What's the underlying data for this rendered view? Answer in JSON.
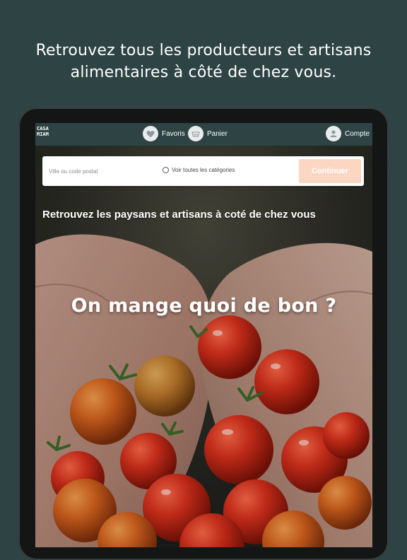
{
  "promo_text": "Retrouvez tous les producteurs et artisans alimentaires à côté de chez vous.",
  "header": {
    "logo_text": "CASA MIAM",
    "favoris_label": "Favoris",
    "panier_label": "Panier",
    "compte_label": "Compte"
  },
  "search": {
    "placeholder": "Ville ou code postal",
    "categories_label": "Voir toutes les catégories",
    "continue_label": "Continuer"
  },
  "hero": {
    "subheading": "Retrouvez les paysans et artisans à coté de chez vous",
    "headline": "On mange quoi de bon ?"
  },
  "colors": {
    "background": "#2e4343",
    "header_bar": "#2e4343",
    "continue_button": "#fbd7c3",
    "tomato": "#d9301c"
  },
  "icons": {
    "favoris": "heart-icon",
    "panier": "basket-icon",
    "compte": "user-icon"
  }
}
